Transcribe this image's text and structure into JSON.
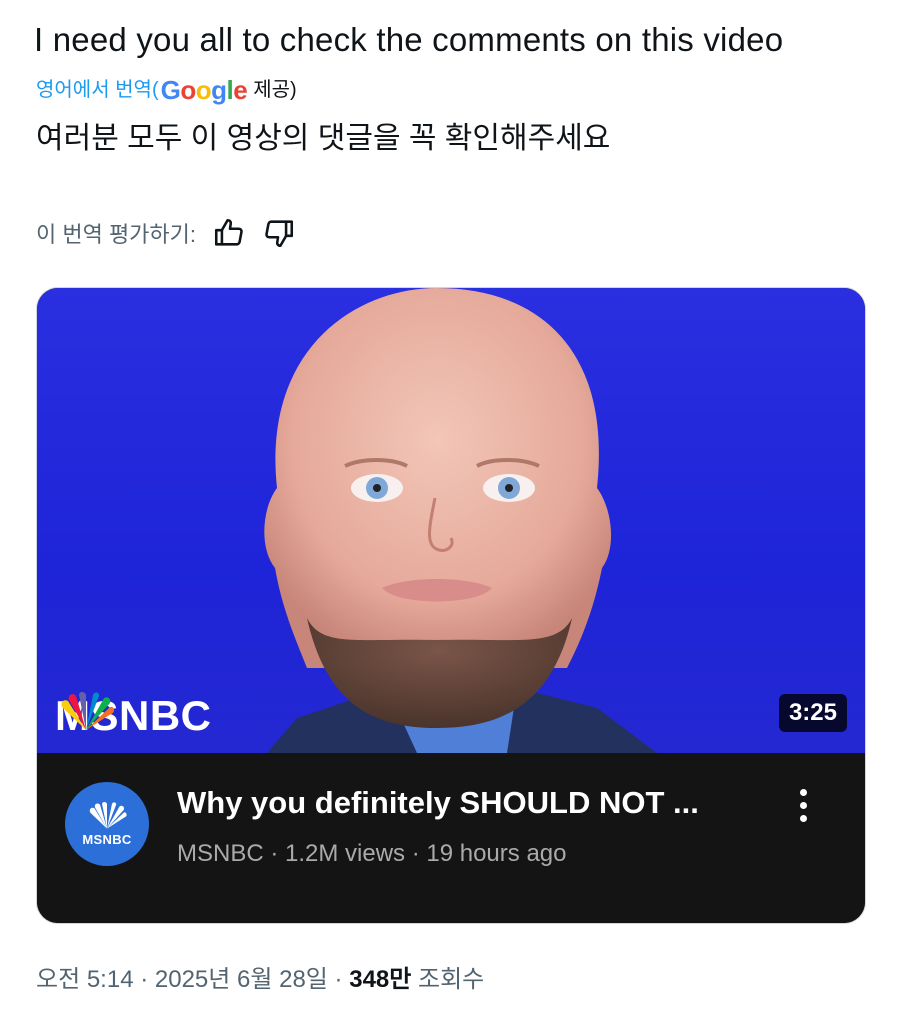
{
  "post": {
    "text": "I need you all to check the comments on this video",
    "translated_from": "영어에서 번역(",
    "translation_provider": "제공)",
    "google_logo": "Google",
    "translation": "여러분 모두 이 영상의 댓글을 꼭 확인해주세요",
    "rate_label": "이 번역 평가하기:"
  },
  "video": {
    "duration": "3:25",
    "brand_overlay": "MSNBC",
    "title": "Why you definitely SHOULD NOT ...",
    "channel": "MSNBC",
    "views": "1.2M views",
    "age": "19 hours ago",
    "avatar_label": "MSNBC",
    "sep": " · "
  },
  "footer": {
    "time": "오전 5:14",
    "date": "2025년 6월 28일",
    "views": "348만",
    "views_label": "조회수",
    "sep": " · "
  },
  "colors": {
    "link": "#1d9bf0",
    "thumb_bg": "#2a2fe0",
    "card_bg": "#141414"
  },
  "icons": [
    "thumbs-up-icon",
    "thumbs-down-icon",
    "nbc-peacock-icon",
    "more-vert-icon"
  ]
}
